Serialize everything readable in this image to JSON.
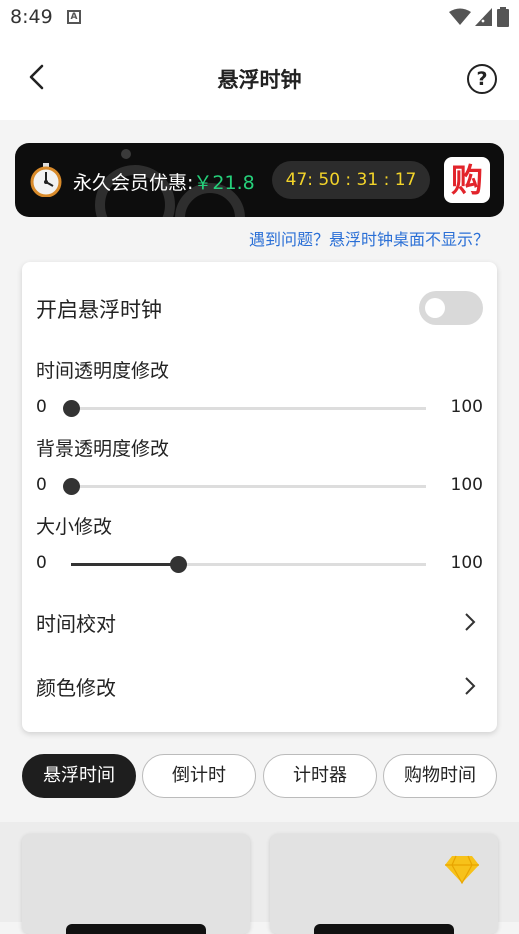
{
  "status": {
    "time": "8:49",
    "a_icon": "A"
  },
  "header": {
    "title": "悬浮时钟",
    "help": "?"
  },
  "promo": {
    "label": "永久会员优惠:",
    "price": "￥21.8",
    "countdown": "47: 50 : 31 : 17",
    "buy": "购"
  },
  "help_link": "遇到问题？悬浮时钟桌面不显示？",
  "settings": {
    "enable_label": "开启悬浮时钟",
    "enabled": false,
    "sliders": [
      {
        "label": "时间透明度修改",
        "min": "0",
        "max": "100",
        "value": 0
      },
      {
        "label": "背景透明度修改",
        "min": "0",
        "max": "100",
        "value": 0
      },
      {
        "label": "大小修改",
        "min": "0",
        "max": "100",
        "value": 30
      }
    ],
    "nav": [
      {
        "label": "时间校对"
      },
      {
        "label": "颜色修改"
      }
    ]
  },
  "tabs": [
    {
      "label": "悬浮时间"
    },
    {
      "label": "倒计时"
    },
    {
      "label": "计时器"
    },
    {
      "label": "购物时间"
    }
  ],
  "colors": {
    "accent_dark": "#1e1e1e",
    "price_green": "#25d07a",
    "countdown_yellow": "#f3d42a",
    "link_blue": "#2a6fd6",
    "buy_red": "#e2242b"
  },
  "icons": [
    "back-arrow-icon",
    "help-icon",
    "stopwatch-icon",
    "chevron-right-icon",
    "diamond-icon",
    "wifi-icon",
    "signal-icon",
    "battery-icon"
  ]
}
